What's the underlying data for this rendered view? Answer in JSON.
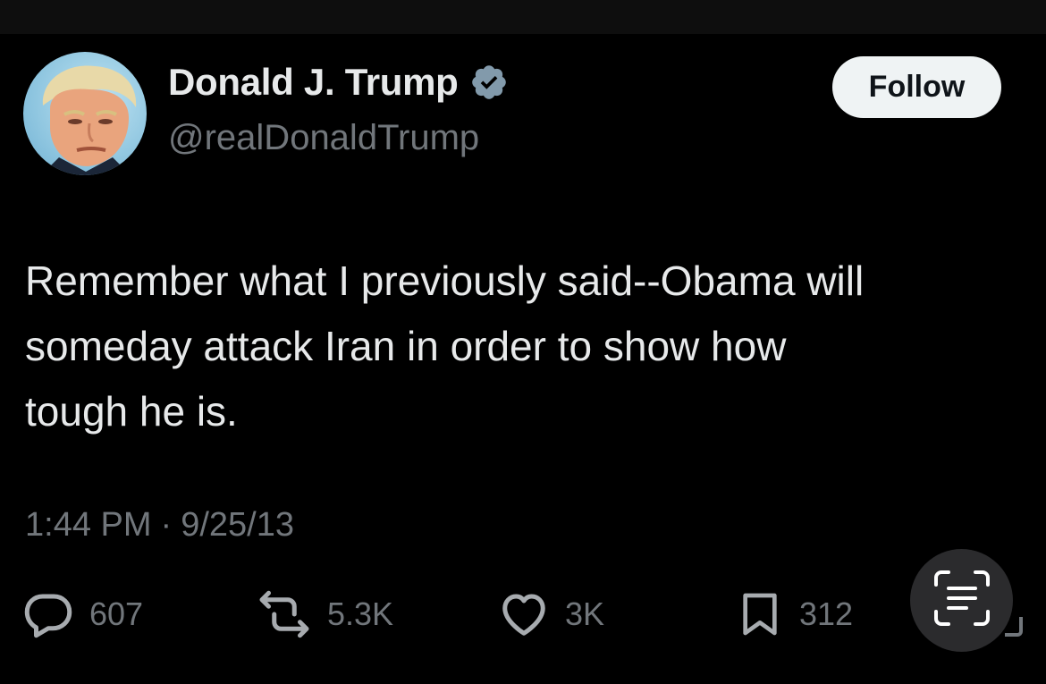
{
  "tweet": {
    "author": {
      "display_name": "Donald J. Trump",
      "handle": "@realDonaldTrump",
      "verified_icon": "verified-badge-icon",
      "avatar": "profile-photo"
    },
    "follow_label": "Follow",
    "text": "Remember what I previously said--Obama will\nsomeday attack Iran in order to show how\ntough he is.",
    "time": "1:44 PM",
    "separator": "·",
    "date": "9/25/13",
    "stats": {
      "replies": "607",
      "retweets": "5.3K",
      "likes": "3K",
      "bookmarks": "312"
    }
  },
  "overlay": {
    "scan_icon": "text-scan-icon"
  },
  "colors": {
    "background": "#000000",
    "primary_text": "#e7e9ea",
    "secondary_text": "#71767b",
    "follow_button_bg": "#eff3f4",
    "verified_badge": "#829aab"
  }
}
